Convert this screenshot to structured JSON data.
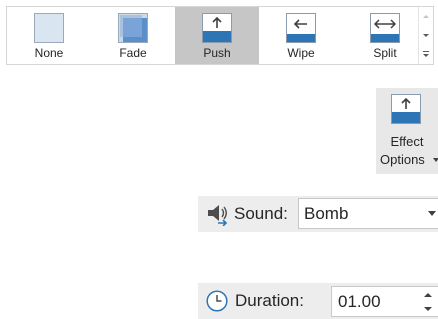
{
  "transitions": {
    "items": [
      {
        "id": "none",
        "label": "None",
        "icon": "none-transition-icon",
        "selected": false
      },
      {
        "id": "fade",
        "label": "Fade",
        "icon": "fade-transition-icon",
        "selected": false
      },
      {
        "id": "push",
        "label": "Push",
        "icon": "push-transition-icon",
        "selected": true
      },
      {
        "id": "wipe",
        "label": "Wipe",
        "icon": "wipe-transition-icon",
        "selected": false
      },
      {
        "id": "split",
        "label": "Split",
        "icon": "split-transition-icon",
        "selected": false
      }
    ],
    "scroll_icons": [
      "scroll-up-icon",
      "scroll-down-icon",
      "more-gallery-icon"
    ]
  },
  "effect_options": {
    "line1": "Effect",
    "line2": "Options",
    "icon": "push-from-bottom-icon",
    "dropdown_icon": "chevron-down-icon"
  },
  "sound": {
    "label": "Sound:",
    "value": "Bomb",
    "icon": "speaker-icon"
  },
  "duration": {
    "label": "Duration:",
    "value": "01.00",
    "icon": "clock-icon"
  },
  "colors": {
    "accent_blue": "#2e75b6",
    "selected_bg": "#c6c6c6",
    "hover_bg": "#e8e8e8",
    "row_bg": "#ededed"
  }
}
